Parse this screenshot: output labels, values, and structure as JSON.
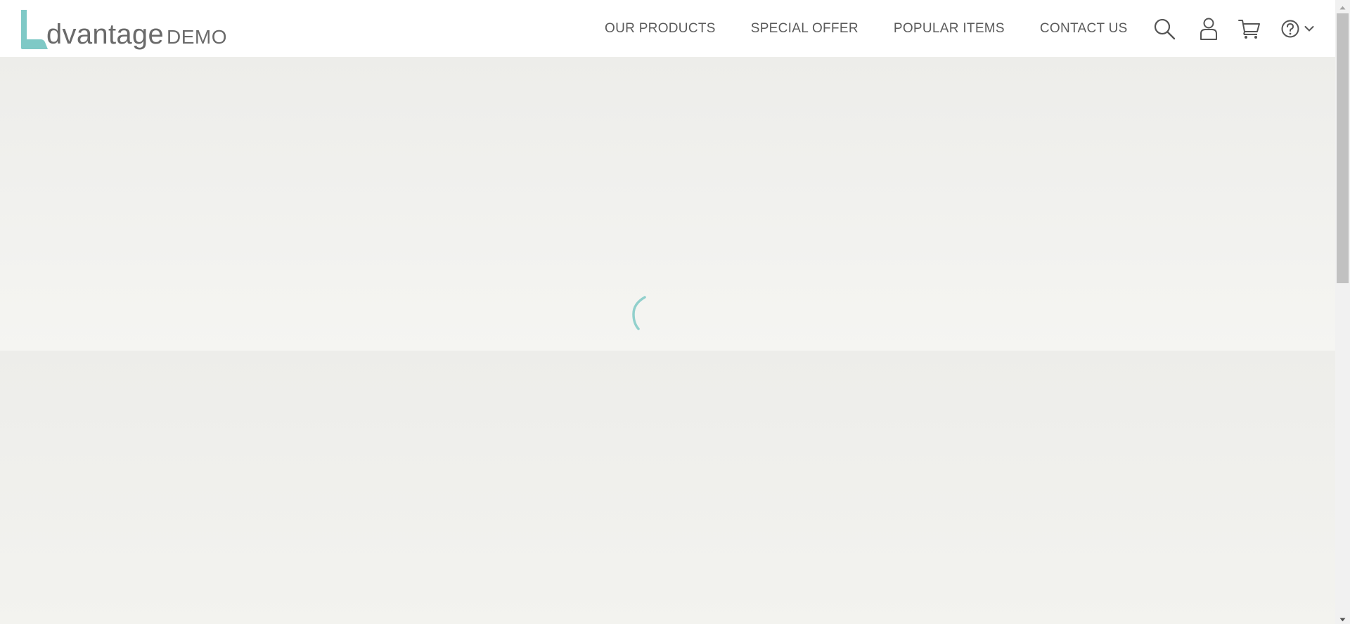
{
  "app": {
    "logo": {
      "word": "dvantage",
      "suffix": "DEMO"
    },
    "colors": {
      "brand_teal": "#7fc9c6",
      "nav_text": "#5b5b5b",
      "background": "#f2f2ef"
    }
  },
  "header": {
    "nav": [
      {
        "label": "OUR PRODUCTS"
      },
      {
        "label": "SPECIAL OFFER"
      },
      {
        "label": "POPULAR ITEMS"
      },
      {
        "label": "CONTACT US"
      }
    ],
    "icons": [
      "search-icon",
      "user-icon",
      "cart-icon",
      "help-icon",
      "chevron-down-icon"
    ]
  },
  "main": {
    "state": "loading"
  }
}
